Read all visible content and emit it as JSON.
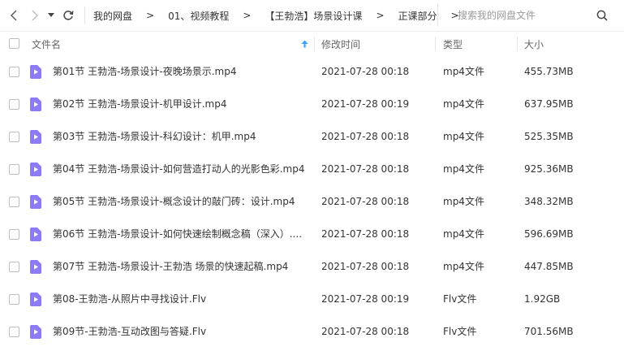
{
  "breadcrumb": [
    "我的网盘",
    "01、视频教程",
    "【王勃浩】场景设计课",
    "正课部分"
  ],
  "breadcrumb_separator": ">",
  "search": {
    "placeholder": "搜索我的网盘文件"
  },
  "columns": {
    "name": "文件名",
    "modified": "修改时间",
    "type": "类型",
    "size": "大小"
  },
  "sort": {
    "column": "name",
    "direction": "ascending"
  },
  "colors": {
    "file_icon": "#8b7cf6",
    "text": "#333333",
    "header_text": "#666666",
    "sort_arrow": "#3aa0ff"
  },
  "files": [
    {
      "name": "第01节 王勃浩-场景设计-夜晚场景示.mp4",
      "modified": "2021-07-28 00:18",
      "type": "mp4文件",
      "size": "455.73MB"
    },
    {
      "name": "第02节 王勃浩-场景设计-机甲设计.mp4",
      "modified": "2021-07-28 00:19",
      "type": "mp4文件",
      "size": "637.95MB"
    },
    {
      "name": "第03节 王勃浩-场景设计-科幻设计：机甲.mp4",
      "modified": "2021-07-28 00:18",
      "type": "mp4文件",
      "size": "525.35MB"
    },
    {
      "name": "第04节 王勃浩-场景设计-如何营造打动人的光影色彩.mp4",
      "modified": "2021-07-28 00:18",
      "type": "mp4文件",
      "size": "925.36MB"
    },
    {
      "name": "第05节 王勃浩-场景设计-概念设计的敲门砖：设计.mp4",
      "modified": "2021-07-28 00:18",
      "type": "mp4文件",
      "size": "348.32MB"
    },
    {
      "name": "第06节 王勃浩-场景设计-如何快速绘制概念稿（深入）....",
      "modified": "2021-07-28 00:18",
      "type": "mp4文件",
      "size": "596.69MB"
    },
    {
      "name": "第07节 王勃浩-场景设计-王勃浩 场景的快速起稿.mp4",
      "modified": "2021-07-28 00:18",
      "type": "mp4文件",
      "size": "447.85MB"
    },
    {
      "name": "第08-王勃浩-从照片中寻找设计.Flv",
      "modified": "2021-07-28 00:19",
      "type": "Flv文件",
      "size": "1.92GB"
    },
    {
      "name": "第09节-王勃浩-互动改图与答疑.Flv",
      "modified": "2021-07-28 00:18",
      "type": "Flv文件",
      "size": "701.56MB"
    }
  ]
}
